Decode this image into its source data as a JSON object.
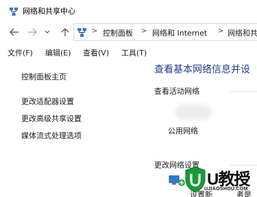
{
  "window": {
    "title": "网络和共享中心"
  },
  "nav": {
    "back_icon": "back-arrow-icon",
    "forward_icon": "forward-arrow-icon",
    "recent_icon": "chevron-down-icon",
    "up_icon": "up-arrow-icon"
  },
  "address": {
    "icon": "control-panel-icon",
    "crumbs": [
      "控制面板",
      "网络和 Internet",
      "网络和共"
    ]
  },
  "menu": {
    "items": [
      "文件(F)",
      "编辑(E)",
      "查看(V)",
      "工具(T)"
    ]
  },
  "left_pane": {
    "links": [
      "控制面板主页",
      "更改适配器设置",
      "更改高级共享设置",
      "媒体流式处理选项"
    ]
  },
  "main": {
    "title": "查看基本网络信息并设",
    "active_networks_label": "查看活动网络",
    "network_type": "公用网络",
    "change_settings_label": "更改网络设置",
    "partial_text_1": "设置新",
    "partial_text_2": "者是"
  },
  "watermark": {
    "text": "U教授",
    "url": "UJIAOSHOU.COM",
    "accent": "#1a9a3a"
  }
}
